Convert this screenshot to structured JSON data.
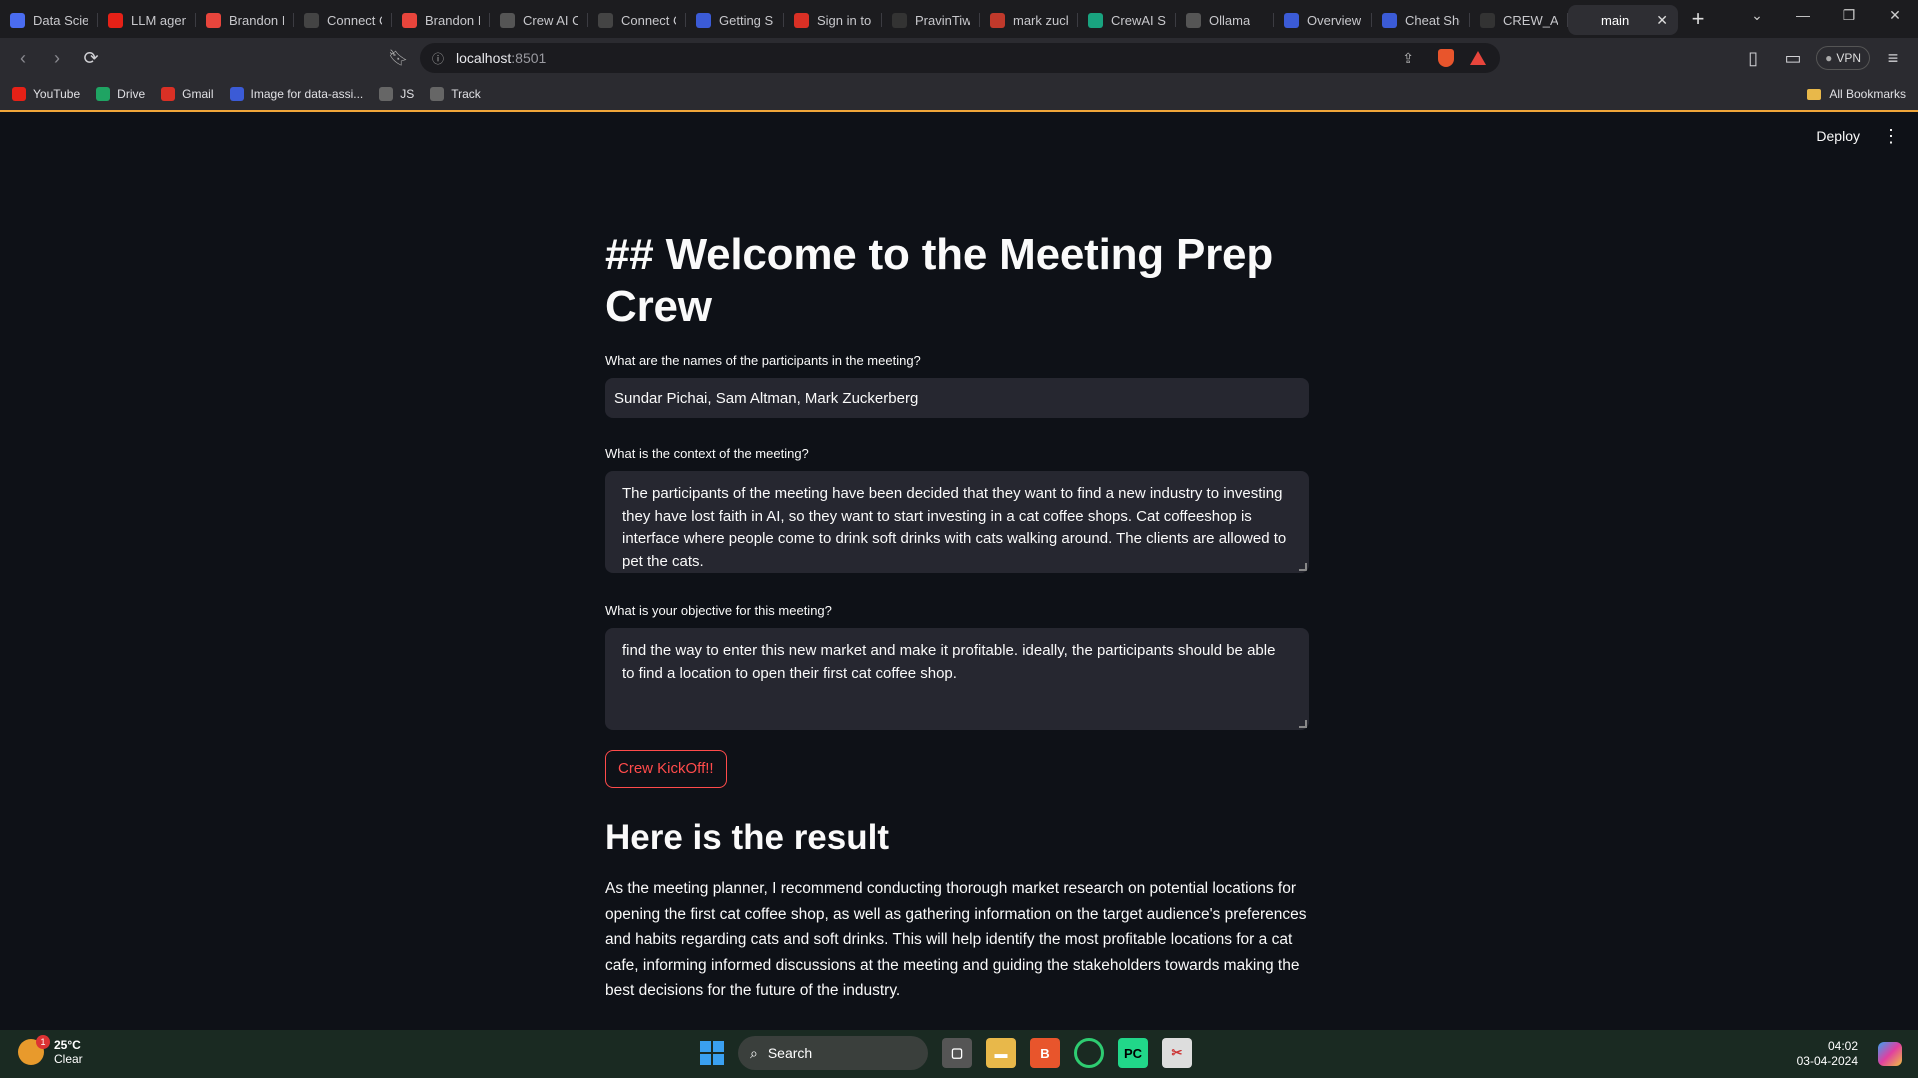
{
  "browser": {
    "tabs": [
      {
        "label": "Data Scier",
        "icon": "app-icon",
        "color": "#4a6cf0"
      },
      {
        "label": "LLM agen",
        "icon": "youtube-icon",
        "color": "#e62117"
      },
      {
        "label": "Brandon I",
        "icon": "opera-icon",
        "color": "#e8453c"
      },
      {
        "label": "Connect C",
        "icon": "github-icon",
        "color": "#444444"
      },
      {
        "label": "Brandon I",
        "icon": "opera-icon",
        "color": "#e8453c"
      },
      {
        "label": "Crew AI C",
        "icon": "crewai-icon",
        "color": "#555555"
      },
      {
        "label": "Connect C",
        "icon": "github-icon",
        "color": "#444444"
      },
      {
        "label": "Getting S",
        "icon": "k-icon",
        "color": "#3b5bd6"
      },
      {
        "label": "Sign in to",
        "icon": "gmail-icon",
        "color": "#d93025"
      },
      {
        "label": "PravinTiw",
        "icon": "github-icon",
        "color": "#333333"
      },
      {
        "label": "mark zuck",
        "icon": "search-icon",
        "color": "#c0392b"
      },
      {
        "label": "CrewAI Sc",
        "icon": "openai-icon",
        "color": "#19a37f"
      },
      {
        "label": "Ollama",
        "icon": "ollama-icon",
        "color": "#555555"
      },
      {
        "label": "Overview",
        "icon": "k-icon",
        "color": "#3b5bd6"
      },
      {
        "label": "Cheat She",
        "icon": "k-icon",
        "color": "#3b5bd6"
      },
      {
        "label": "CREW_AI",
        "icon": "crew-icon",
        "color": "#333333"
      },
      {
        "label": "main",
        "icon": "streamlit-icon",
        "color": "#2e2e33",
        "active": true
      }
    ],
    "url_host": "localhost",
    "url_port": ":8501",
    "vpn_label": "VPN",
    "bookmarks": [
      {
        "label": "YouTube",
        "icon": "youtube-icon",
        "color": "#e62117"
      },
      {
        "label": "Drive",
        "icon": "drive-icon",
        "color": "#1fa463"
      },
      {
        "label": "Gmail",
        "icon": "gmail-icon",
        "color": "#d93025"
      },
      {
        "label": "Image for data-assi...",
        "icon": "k-icon",
        "color": "#3b5bd6"
      },
      {
        "label": "JS",
        "icon": "globe-icon",
        "color": "#666666"
      },
      {
        "label": "Track",
        "icon": "globe-icon",
        "color": "#666666"
      }
    ],
    "all_bookmarks": "All Bookmarks"
  },
  "app": {
    "deploy_label": "Deploy",
    "title": "## Welcome to the Meeting Prep Crew",
    "participants_label": "What are the names of the participants in the meeting?",
    "participants_value": "Sundar Pichai, Sam Altman, Mark Zuckerberg",
    "context_label": "What is the context of the meeting?",
    "context_value": "The participants of the meeting have been decided that they want to find a new industry to investing they have lost faith in AI, so they want to start investing in a cat coffee shops. Cat coffeeshop is interface where people come to drink soft drinks with cats walking around. The clients are allowed to pet the cats.",
    "objective_label": "What is your objective for this meeting?",
    "objective_value": "find the way to enter this new market and make it profitable. ideally, the participants should be able to find a location to open their first cat coffee shop.",
    "button_label": "Crew KickOff!!",
    "result_heading": "Here is the result",
    "result_text": "As the meeting planner, I recommend conducting thorough market research on potential locations for opening the first cat coffee shop, as well as gathering information on the target audience's preferences and habits regarding cats and soft drinks. This will help identify the most profitable locations for a cat cafe, informing informed discussions at the meeting and guiding the stakeholders towards making the best decisions for the future of the industry."
  },
  "taskbar": {
    "temperature": "25°C",
    "weather": "Clear",
    "weather_badge": "1",
    "search_label": "Search",
    "time": "04:02",
    "date": "03-04-2024"
  },
  "colors": {
    "accent": "#ff4b4b",
    "background": "#0e1117",
    "input_bg": "#262730"
  }
}
